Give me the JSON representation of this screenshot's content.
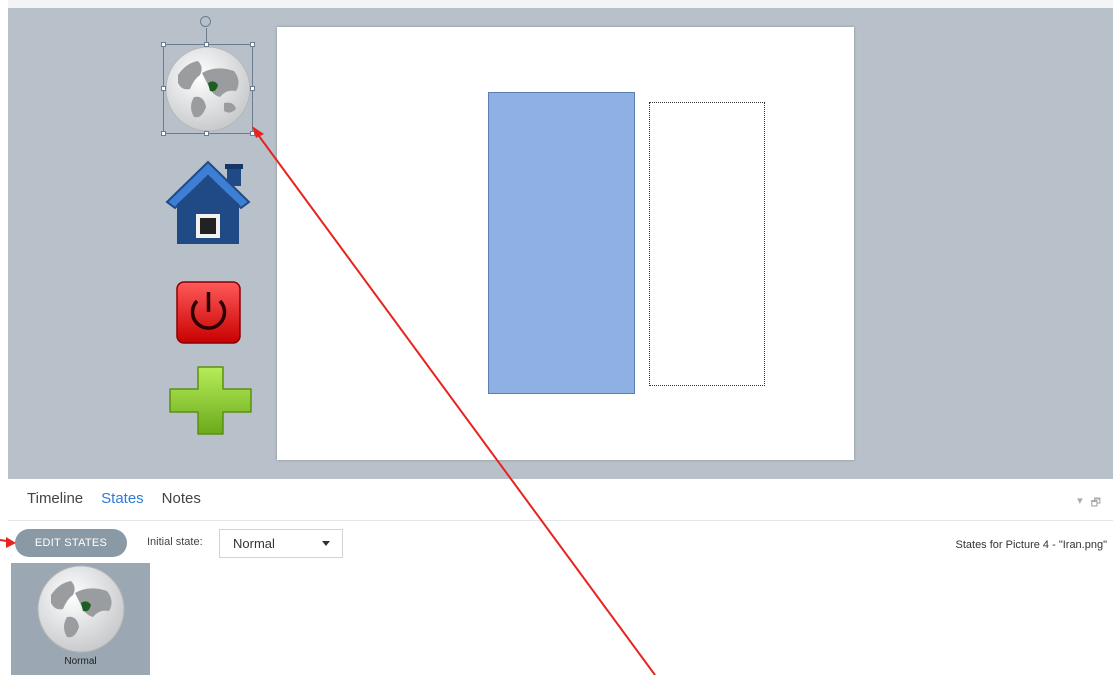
{
  "panel": {
    "tabs": [
      {
        "label": "Timeline"
      },
      {
        "label": "States",
        "active": true
      },
      {
        "label": "Notes"
      }
    ],
    "edit_states_label": "EDIT STATES",
    "initial_state_label": "Initial state:",
    "initial_state_value": "Normal",
    "states_for_text": "States for Picture 4 - \"Iran.png\"",
    "state_thumbnail_caption": "Normal"
  },
  "icons": [
    "globe-iran-icon",
    "home-icon",
    "power-icon",
    "plus-icon"
  ],
  "colors": {
    "workspace": "#b8c1c9",
    "blue_rect": "#8eb0e3",
    "active_tab": "#2e7bd6",
    "annotation_arrow": "#e8231f"
  }
}
